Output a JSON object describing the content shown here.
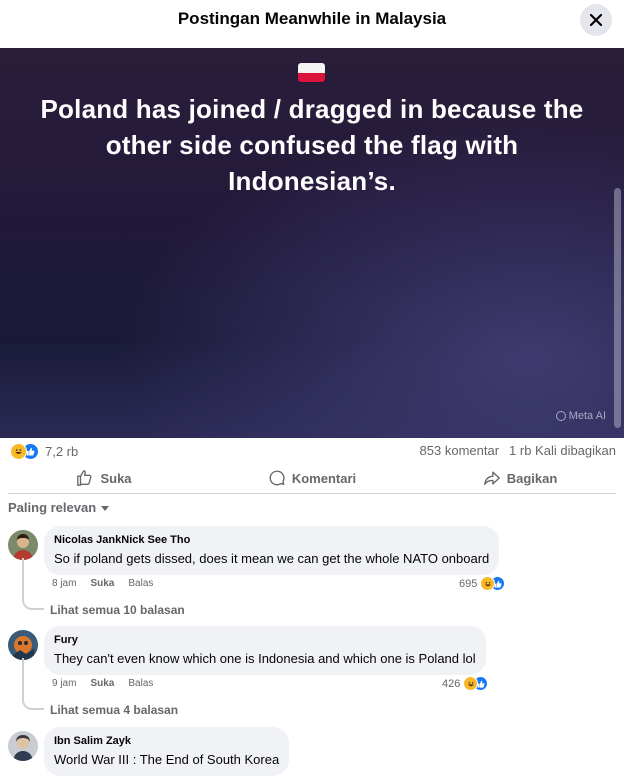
{
  "header": {
    "title": "Postingan Meanwhile in Malaysia",
    "close_icon": "close-icon"
  },
  "post": {
    "image_text": "Poland has joined / dragged in because the other side confused the flag with Indonesian’s.",
    "flag": "poland-flag-emoji",
    "watermark": "Meta AI",
    "colors": {
      "background_top": "#2a1e3a",
      "background_bottom": "#2b2a55",
      "text": "#ffffff"
    }
  },
  "stats": {
    "reaction_count": "7,2 rb",
    "comments": "853 komentar",
    "shares": "1 rb Kali dibagikan"
  },
  "actions": {
    "like": "Suka",
    "comment": "Komentari",
    "share": "Bagikan"
  },
  "sort": {
    "label": "Paling relevan"
  },
  "comments": [
    {
      "author": "Nicolas JankNick See Tho",
      "text": "So if poland gets dissed, does it mean we can get the whole NATO onboard",
      "time": "8 jam",
      "like": "Suka",
      "reply": "Balas",
      "reactions": "695",
      "see_replies": "Lihat semua 10 balasan"
    },
    {
      "author": "Fury",
      "text": "They can't even know which one is Indonesia and which one is Poland lol",
      "time": "9 jam",
      "like": "Suka",
      "reply": "Balas",
      "reactions": "426",
      "see_replies": "Lihat semua 4 balasan"
    },
    {
      "author": "Ibn Salim Zayk",
      "text": "World War III : The End of South Korea"
    }
  ],
  "colors": {
    "accent": "#1877f2",
    "haha": "#f7b928",
    "secondary_text": "#65676b",
    "bubble": "#f0f2f5"
  }
}
